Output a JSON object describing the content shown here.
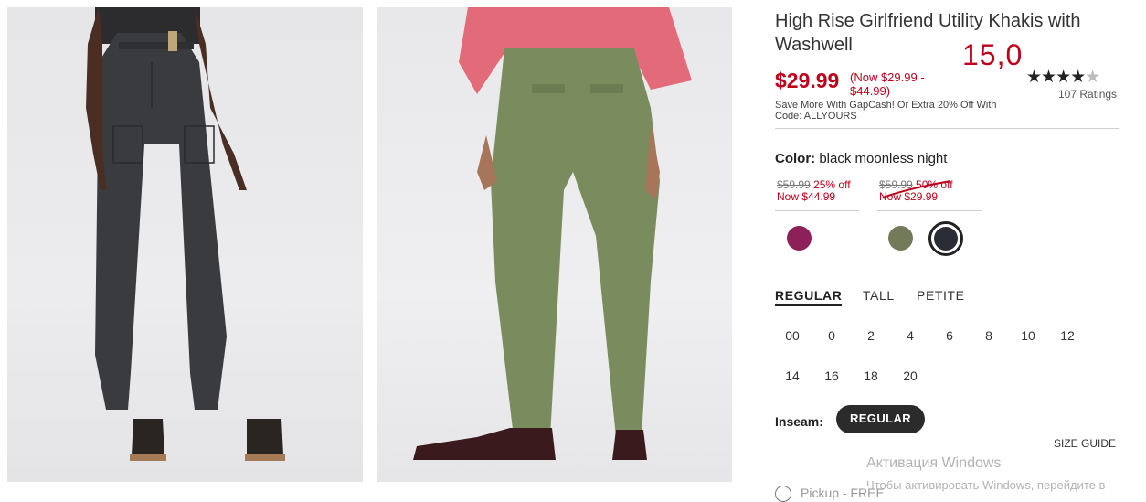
{
  "product": {
    "title": "High Rise Girlfriend Utility Khakis with Washwell",
    "overlay_number": "15,0",
    "price": "$29.99",
    "price_range": "(Now $29.99 - $44.99)",
    "rating_stars": "★★★★",
    "rating_half": "★",
    "ratings_count": "107 Ratings",
    "promo": "Save More With GapCash! Or Extra 20% Off With Code: ALLYOURS",
    "accent_color": "#c0001a"
  },
  "images": [
    {
      "name": "front-view-black",
      "color": "#3a3b3e"
    },
    {
      "name": "back-view-green",
      "color": "#7a8c5e"
    }
  ],
  "color": {
    "label": "Color:",
    "selected": "black moonless night",
    "groups": [
      {
        "was": "$59.99",
        "discount": "25% off",
        "now": "Now $44.99"
      },
      {
        "was": "$59.99",
        "discount": "50% off",
        "now": "Now $29.99"
      }
    ],
    "swatches": [
      {
        "name": "magenta",
        "hex": "#8e2059"
      },
      {
        "name": "olive",
        "hex": "#737a5a"
      },
      {
        "name": "black moonless night",
        "hex": "#2a2d36",
        "selected": true
      }
    ]
  },
  "fit_tabs": [
    "REGULAR",
    "TALL",
    "PETITE"
  ],
  "sizes": [
    "00",
    "0",
    "2",
    "4",
    "6",
    "8",
    "10",
    "12",
    "14",
    "16",
    "18",
    "20"
  ],
  "inseam": {
    "label": "Inseam:",
    "option": "REGULAR"
  },
  "size_guide": "SIZE GUIDE",
  "pickup": "Pickup - FREE",
  "watermark": {
    "line1": "Активация Windows",
    "line2": "Чтобы активировать Windows, перейдите в"
  }
}
